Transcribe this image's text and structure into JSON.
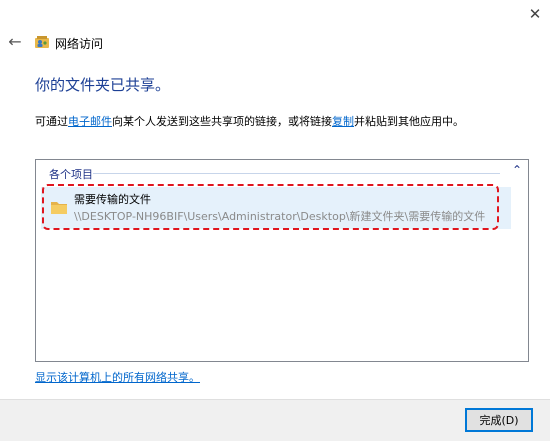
{
  "window": {
    "title": "网络访问",
    "close_icon": "✕",
    "back_icon": "←"
  },
  "main": {
    "heading": "你的文件夹已共享。",
    "description_prefix": "可通过",
    "email_link": "电子邮件",
    "description_middle": "向某个人发送到这些共享项的链接，或将链接",
    "copy_link": "复制",
    "description_suffix": "并粘贴到其他应用中。"
  },
  "list": {
    "group_label": "各个项目",
    "collapse_icon": "⌃",
    "items": [
      {
        "name": "需要传输的文件",
        "path": "\\\\DESKTOP-NH96BIF\\Users\\Administrator\\Desktop\\新建文件夹\\需要传输的文件",
        "icon": "folder-icon"
      }
    ]
  },
  "footer_link": "显示该计算机上的所有网络共享。",
  "buttons": {
    "finish": "完成(D)"
  },
  "colors": {
    "heading": "#1c3f95",
    "link": "#0066cc",
    "selection": "#e5f1fb",
    "highlight_border": "#e0151e"
  }
}
